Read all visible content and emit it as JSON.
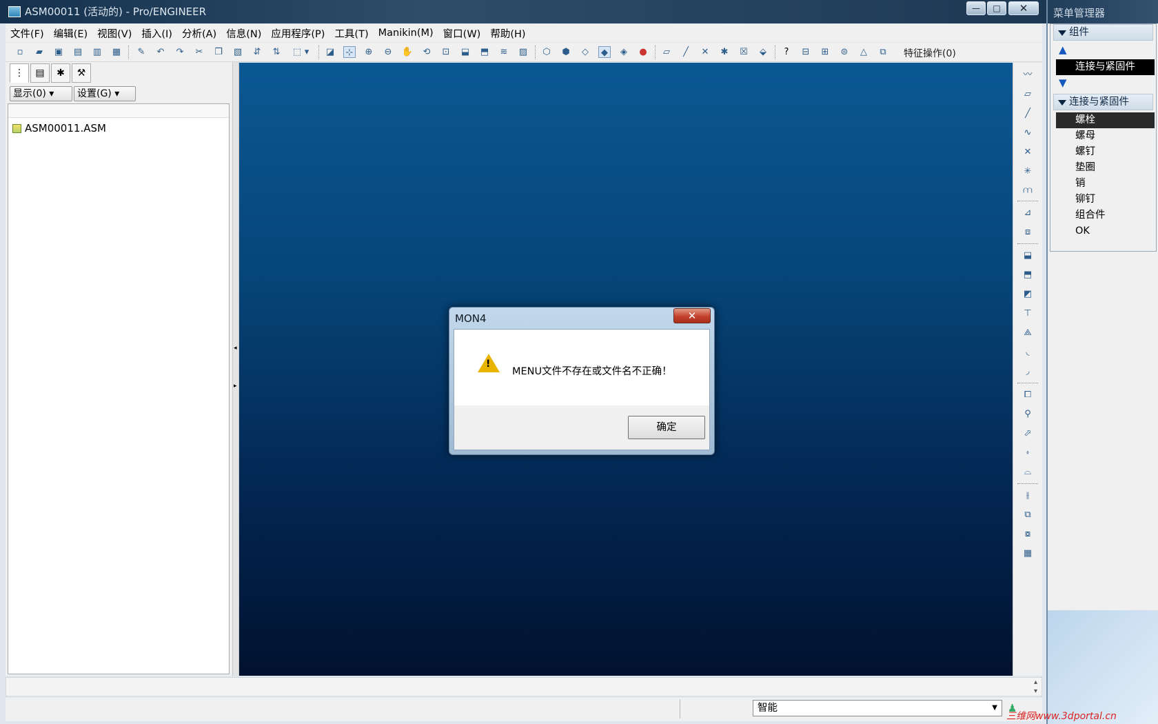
{
  "window": {
    "title": "ASM00011 (活动的) - Pro/ENGINEER",
    "controls": {
      "minimize": "—",
      "maximize": "□",
      "close": "✕"
    }
  },
  "menubar": [
    "文件(F)",
    "编辑(E)",
    "视图(V)",
    "插入(I)",
    "分析(A)",
    "信息(N)",
    "应用程序(P)",
    "工具(T)",
    "Manikin(M)",
    "窗口(W)",
    "帮助(H)"
  ],
  "toolbar": {
    "feature_ops": "特征操作(0)",
    "icons": [
      "new-icon",
      "open-icon",
      "save-icon",
      "save-copy-icon",
      "backup-icon",
      "print-icon",
      "edit-icon",
      "undo-icon",
      "redo-icon",
      "cut-icon",
      "copy-icon",
      "paste-icon",
      "regenerate-icon",
      "regen-manager-icon",
      "select-box-icon",
      "repaint-icon",
      "spin-center-icon",
      "zoom-in-icon",
      "zoom-out-icon",
      "pan-icon",
      "orient-icon",
      "refit-icon",
      "saved-views-icon",
      "annotation-icon",
      "layers-icon",
      "view-manager-icon",
      "wireframe-icon",
      "hidden-line-icon",
      "no-hidden-icon",
      "shading-icon",
      "enhanced-realism-icon",
      "appearance-icon",
      "datum-planes-icon",
      "datum-axes-icon",
      "datum-points-icon",
      "coord-sys-icon",
      "spin-center-display-icon",
      "annotation-display-icon",
      "whats-this-icon",
      "measure-icon",
      "section-icon",
      "mass-props-icon",
      "draft-check-icon",
      "component-icon"
    ]
  },
  "left_panel": {
    "tabs": [
      "model-tree-icon",
      "folder-browser-icon",
      "favorites-icon",
      "connections-icon"
    ],
    "show_button": "显示(0)",
    "settings_button": "设置(G)",
    "tree_items": [
      "ASM00011.ASM"
    ]
  },
  "right_toolbar": {
    "icons": [
      "sketch-icon",
      "datum-plane-icon",
      "datum-axis-icon",
      "datum-curve-icon",
      "datum-point-icon",
      "offset-point-icon",
      "field-point-icon",
      "csys-icon",
      "analysis-feature-icon",
      "assemble-icon",
      "create-component-icon",
      "package-icon",
      "repeat-icon",
      "skeleton-icon",
      "cut-feature-icon",
      "hole-icon",
      "round-icon",
      "chamfer-icon",
      "pattern-icon",
      "mirror-icon",
      "merge-icon",
      "shell-icon",
      "intersect-icon",
      "grid-icon"
    ]
  },
  "status": {
    "filter_value": "智能"
  },
  "menu_manager": {
    "title": "菜单管理器",
    "group1_header": "组件",
    "group1_selected": "连接与紧固件",
    "group2_header": "连接与紧固件",
    "items": [
      "螺栓",
      "螺母",
      "螺钉",
      "垫圈",
      "销",
      "铆钉",
      "组合件",
      "OK"
    ],
    "selected_index": 0
  },
  "dialog": {
    "title": "MON4",
    "message": "MENU文件不存在或文件名不正确！",
    "ok": "确定",
    "close": "✕"
  },
  "watermark": "三维网www.3dportal.cn"
}
